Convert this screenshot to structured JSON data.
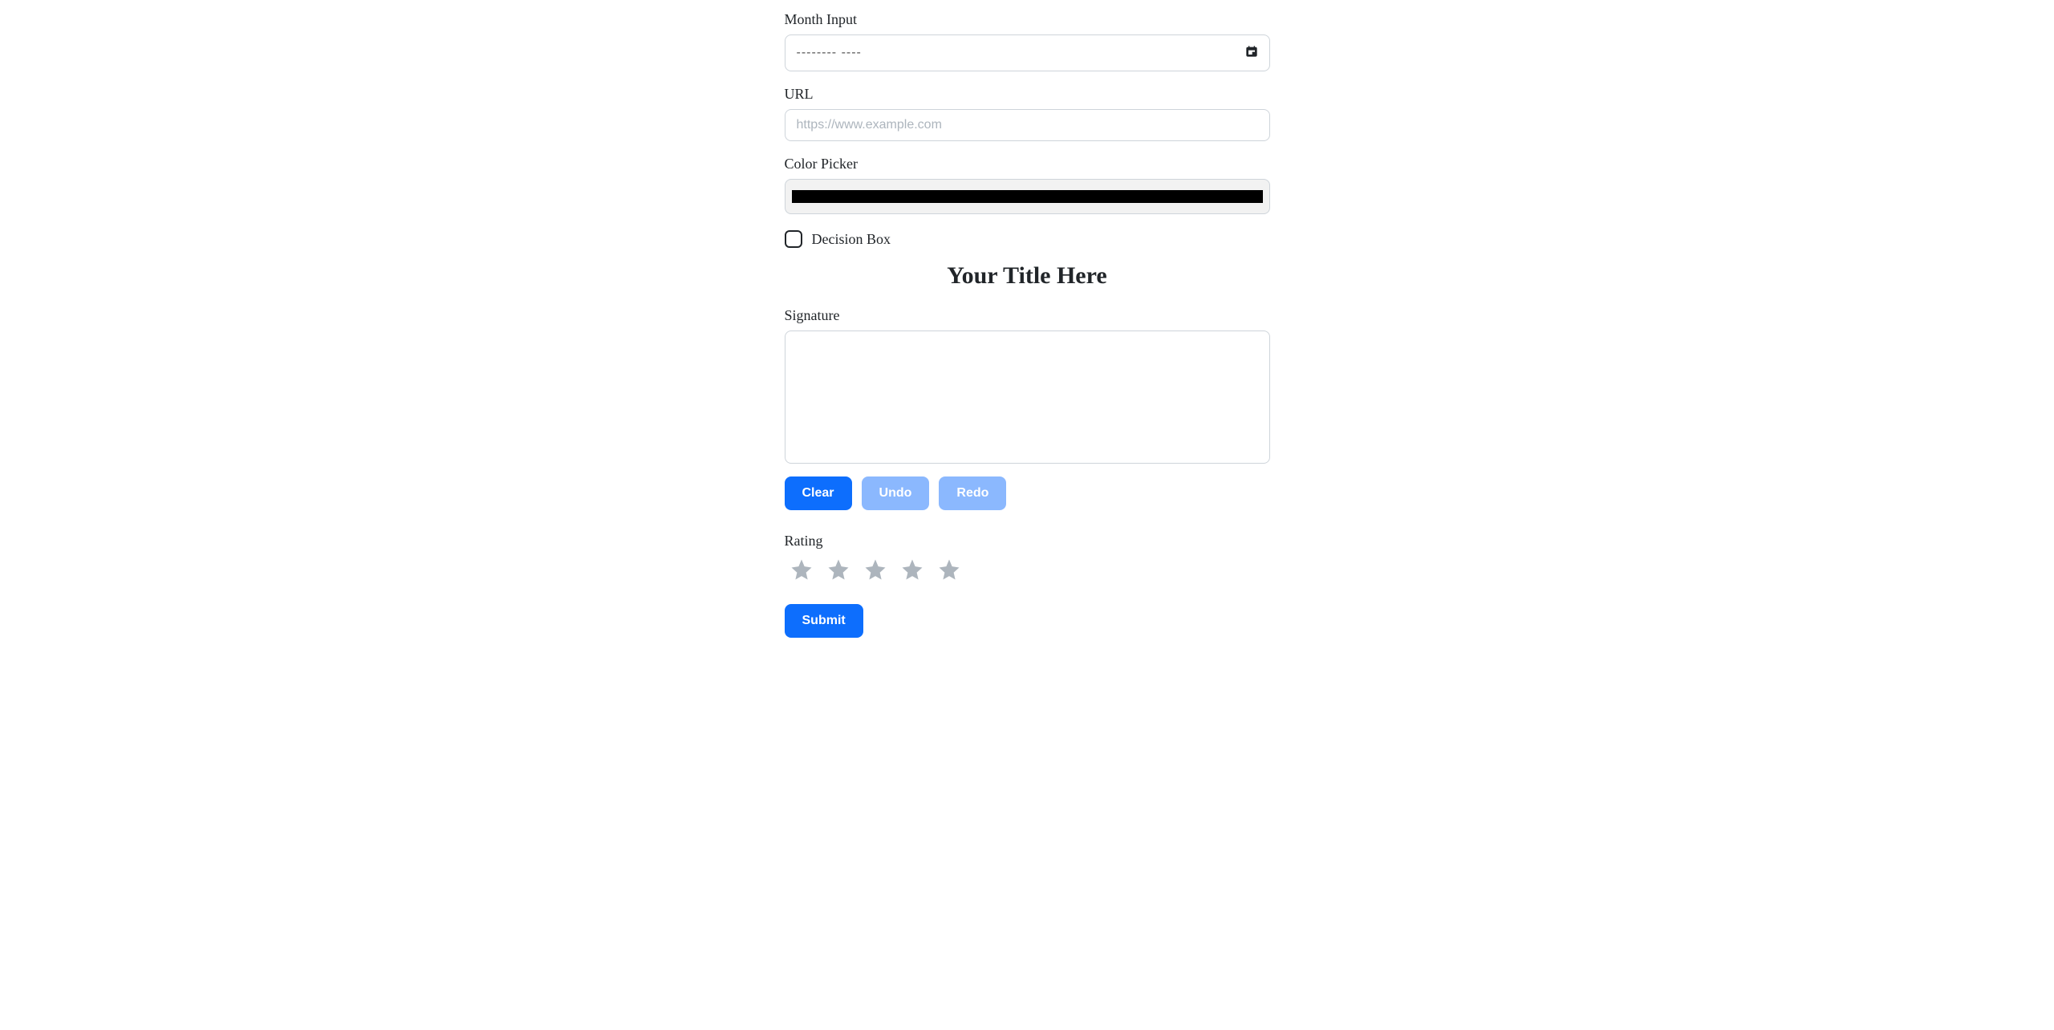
{
  "month": {
    "label": "Month Input",
    "placeholder": "--------  ----"
  },
  "url": {
    "label": "URL",
    "placeholder": "https://www.example.com"
  },
  "color": {
    "label": "Color Picker",
    "value": "#000000"
  },
  "decision": {
    "label": "Decision Box"
  },
  "section_title": "Your Title Here",
  "signature": {
    "label": "Signature",
    "buttons": {
      "clear": "Clear",
      "undo": "Undo",
      "redo": "Redo"
    }
  },
  "rating": {
    "label": "Rating",
    "stars": 5
  },
  "submit_label": "Submit"
}
